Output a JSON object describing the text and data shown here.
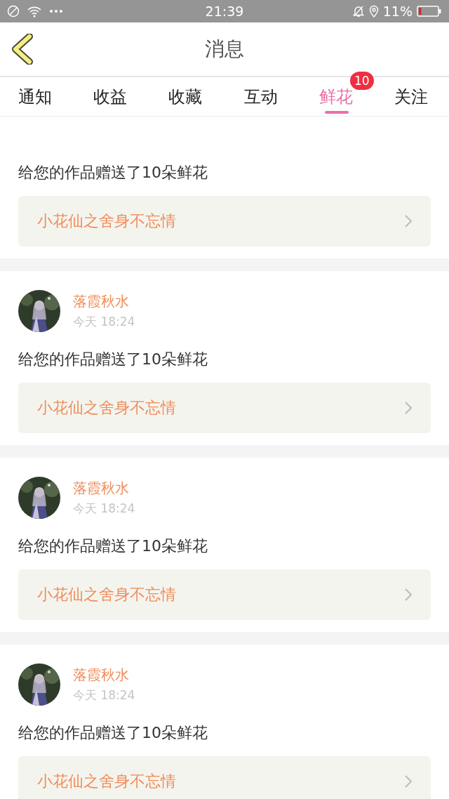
{
  "status_bar": {
    "time": "21:39",
    "battery_text": "11%"
  },
  "header": {
    "title": "消息"
  },
  "tabs": [
    {
      "label": "通知",
      "selected": false
    },
    {
      "label": "收益",
      "selected": false
    },
    {
      "label": "收藏",
      "selected": false
    },
    {
      "label": "互动",
      "selected": false
    },
    {
      "label": "鲜花",
      "selected": true,
      "badge": "10"
    },
    {
      "label": "关注",
      "selected": false
    }
  ],
  "messages": [
    {
      "text": "给您的作品赠送了10朵鲜花",
      "work": "小花仙之舍身不忘情"
    },
    {
      "name": "落霞秋水",
      "time": "今天 18:24",
      "text": "给您的作品赠送了10朵鲜花",
      "work": "小花仙之舍身不忘情"
    },
    {
      "name": "落霞秋水",
      "time": "今天 18:24",
      "text": "给您的作品赠送了10朵鲜花",
      "work": "小花仙之舍身不忘情"
    },
    {
      "name": "落霞秋水",
      "time": "今天 18:24",
      "text": "给您的作品赠送了10朵鲜花",
      "work": "小花仙之舍身不忘情"
    }
  ]
}
